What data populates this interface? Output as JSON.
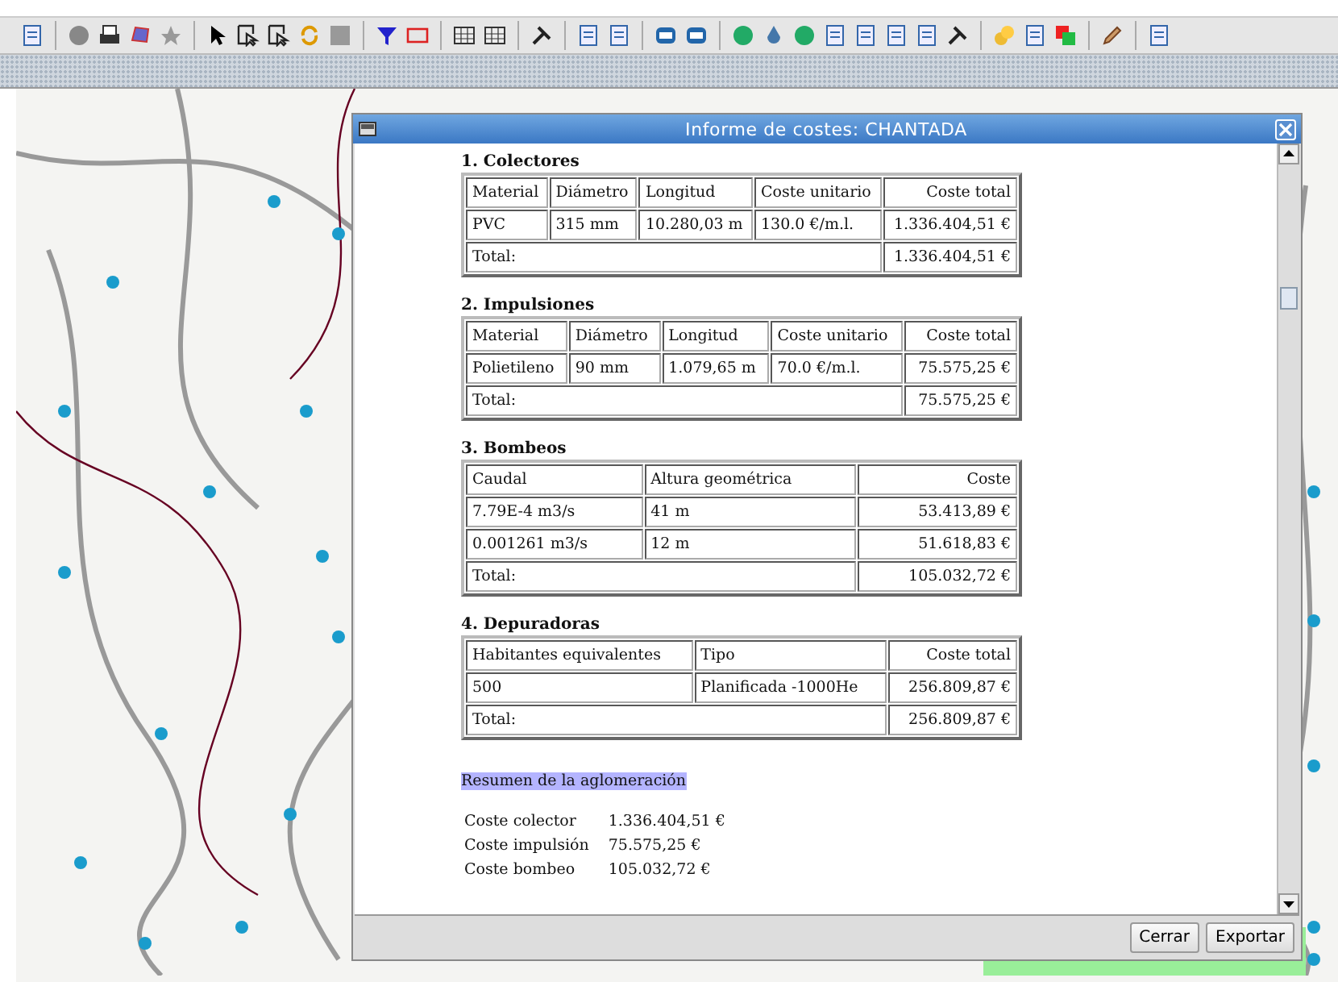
{
  "dialog": {
    "title": "Informe de costes: CHANTADA",
    "sections": [
      {
        "heading": "1. Colectores",
        "columns": [
          "Material",
          "Diámetro",
          "Longitud",
          "Coste unitario",
          "Coste total"
        ],
        "rows": [
          [
            "PVC",
            "315 mm",
            "10.280,03 m",
            "130.0 €/m.l.",
            "1.336.404,51 €"
          ]
        ],
        "total_label": "Total:",
        "total": "1.336.404,51 €"
      },
      {
        "heading": "2. Impulsiones",
        "columns": [
          "Material",
          "Diámetro",
          "Longitud",
          "Coste unitario",
          "Coste total"
        ],
        "rows": [
          [
            "Polietileno",
            "90 mm",
            "1.079,65 m",
            "70.0 €/m.l.",
            "75.575,25 €"
          ]
        ],
        "total_label": "Total:",
        "total": "75.575,25 €"
      },
      {
        "heading": "3. Bombeos",
        "columns": [
          "Caudal",
          "Altura geométrica",
          "Coste"
        ],
        "rows": [
          [
            "7.79E-4 m3/s",
            "41 m",
            "53.413,89 €"
          ],
          [
            "0.001261 m3/s",
            "12 m",
            "51.618,83 €"
          ]
        ],
        "total_label": "Total:",
        "total": "105.032,72 €"
      },
      {
        "heading": "4. Depuradoras",
        "columns": [
          "Habitantes equivalentes",
          "Tipo",
          "Coste total"
        ],
        "rows": [
          [
            "500",
            "Planificada -1000He",
            "256.809,87 €"
          ]
        ],
        "total_label": "Total:",
        "total": "256.809,87 €"
      }
    ],
    "summary": {
      "heading": "Resumen de la aglomeración",
      "rows": [
        {
          "label": "Coste colector",
          "value": "1.336.404,51 €"
        },
        {
          "label": "Coste impulsión",
          "value": "75.575,25 €"
        },
        {
          "label": "Coste bombeo",
          "value": "105.032,72 €"
        }
      ]
    },
    "buttons": [
      "Cerrar",
      "Exportar"
    ]
  }
}
